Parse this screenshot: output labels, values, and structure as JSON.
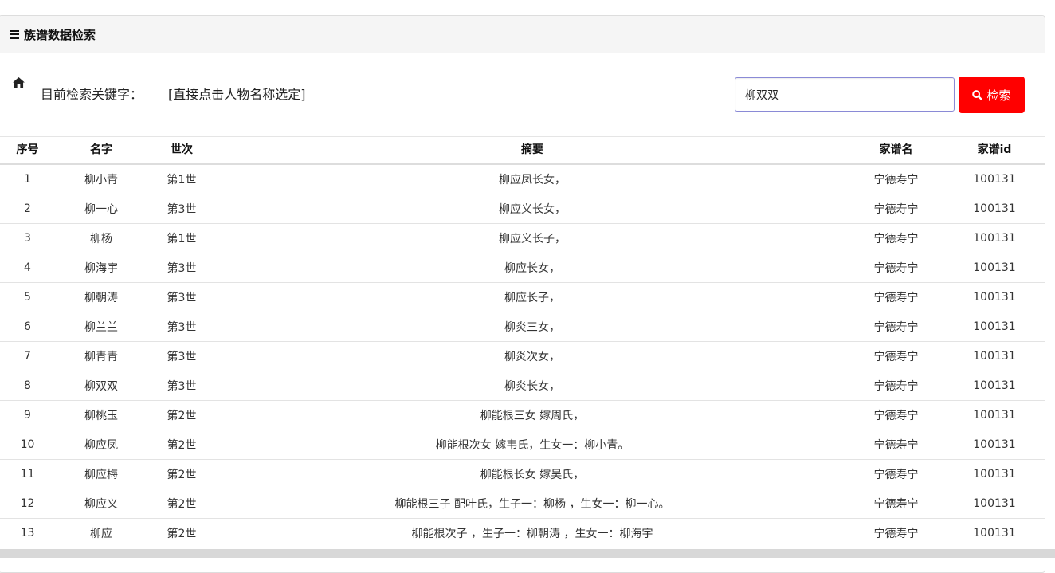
{
  "panel": {
    "title": "族谱数据检索"
  },
  "search": {
    "label": "目前检索关键字：",
    "hint": "[直接点击人物名称选定]",
    "value": "柳双双",
    "button_label": "检索"
  },
  "table": {
    "headers": {
      "index": "序号",
      "name": "名字",
      "generation": "世次",
      "summary": "摘要",
      "book": "家谱名",
      "book_id": "家谱id"
    },
    "rows": [
      {
        "index": "1",
        "name": "柳小青",
        "generation": "第1世",
        "summary": "柳应凤长女，",
        "book": "宁德寿宁",
        "book_id": "100131"
      },
      {
        "index": "2",
        "name": "柳一心",
        "generation": "第3世",
        "summary": "柳应义长女，",
        "book": "宁德寿宁",
        "book_id": "100131"
      },
      {
        "index": "3",
        "name": "柳杨",
        "generation": "第1世",
        "summary": "柳应义长子，",
        "book": "宁德寿宁",
        "book_id": "100131"
      },
      {
        "index": "4",
        "name": "柳海宇",
        "generation": "第3世",
        "summary": "柳应长女，",
        "book": "宁德寿宁",
        "book_id": "100131"
      },
      {
        "index": "5",
        "name": "柳朝涛",
        "generation": "第3世",
        "summary": "柳应长子，",
        "book": "宁德寿宁",
        "book_id": "100131"
      },
      {
        "index": "6",
        "name": "柳兰兰",
        "generation": "第3世",
        "summary": "柳炎三女，",
        "book": "宁德寿宁",
        "book_id": "100131"
      },
      {
        "index": "7",
        "name": "柳青青",
        "generation": "第3世",
        "summary": "柳炎次女，",
        "book": "宁德寿宁",
        "book_id": "100131"
      },
      {
        "index": "8",
        "name": "柳双双",
        "generation": "第3世",
        "summary": "柳炎长女，",
        "book": "宁德寿宁",
        "book_id": "100131"
      },
      {
        "index": "9",
        "name": "柳桃玉",
        "generation": "第2世",
        "summary": "柳能根三女 嫁周氏，",
        "book": "宁德寿宁",
        "book_id": "100131"
      },
      {
        "index": "10",
        "name": "柳应凤",
        "generation": "第2世",
        "summary": "柳能根次女 嫁韦氏，生女一：柳小青。",
        "book": "宁德寿宁",
        "book_id": "100131"
      },
      {
        "index": "11",
        "name": "柳应梅",
        "generation": "第2世",
        "summary": "柳能根长女 嫁吴氏，",
        "book": "宁德寿宁",
        "book_id": "100131"
      },
      {
        "index": "12",
        "name": "柳应义",
        "generation": "第2世",
        "summary": "柳能根三子 配叶氏，生子一：柳杨 ，生女一：柳一心。",
        "book": "宁德寿宁",
        "book_id": "100131"
      },
      {
        "index": "13",
        "name": "柳应",
        "generation": "第2世",
        "summary": "柳能根次子 ，生子一：柳朝涛 ，生女一：柳海宇",
        "book": "宁德寿宁",
        "book_id": "100131"
      }
    ]
  },
  "colors": {
    "search_button": "#ff0000",
    "heading_bg": "#f5f5f5",
    "input_border": "#8a8ad6"
  }
}
